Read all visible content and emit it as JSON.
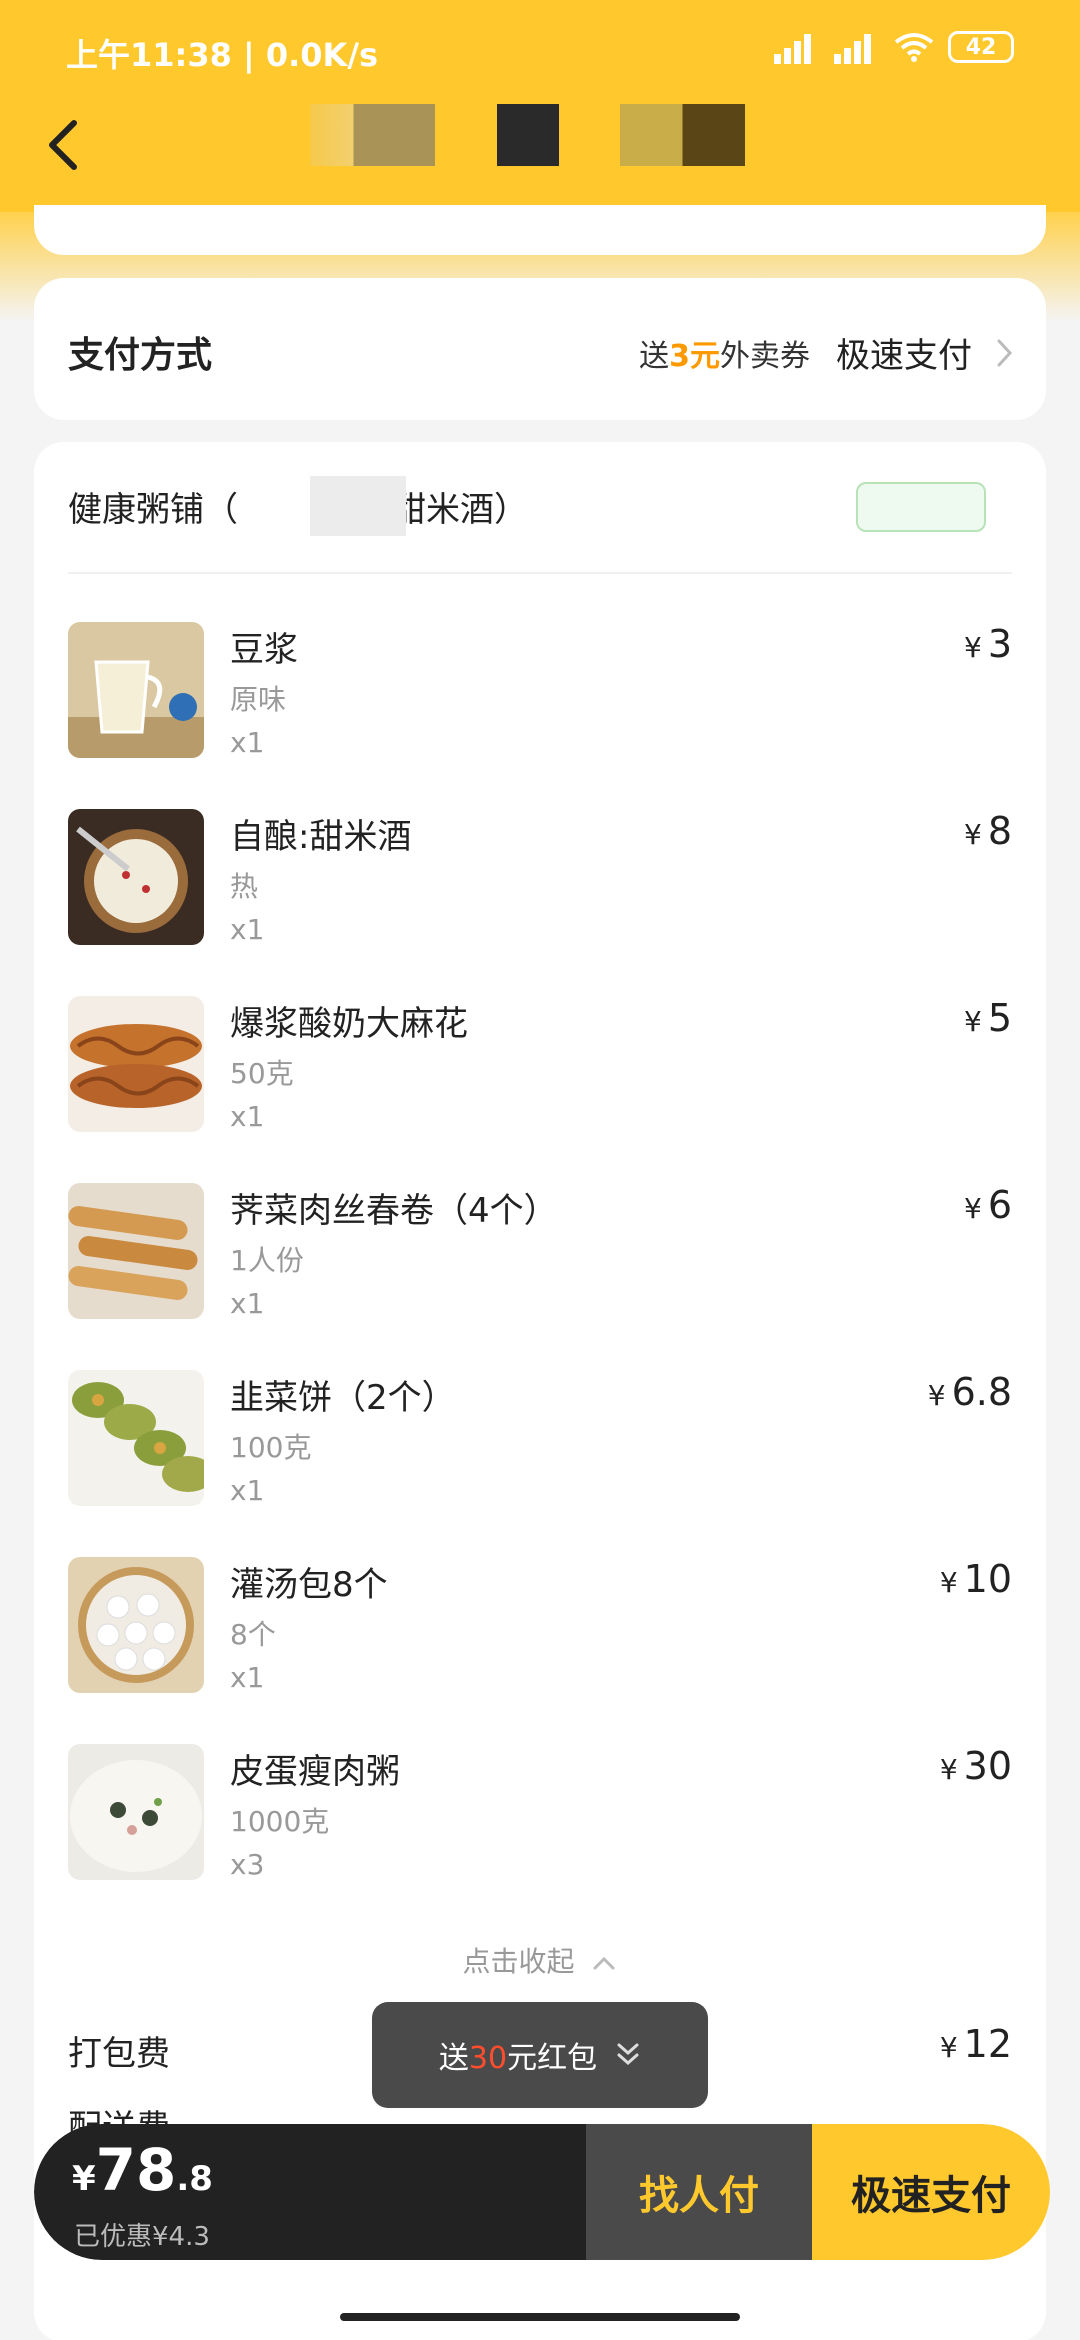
{
  "status_bar": {
    "time": "上午11:38 | 0.0K/s",
    "battery": "42"
  },
  "payment": {
    "title": "支付方式",
    "promo_prefix": "送",
    "promo_amount": "3元",
    "promo_suffix": "外卖券",
    "method": "极速支付"
  },
  "shop": {
    "name": "健康粥铺（",
    "name_tail": "，甜米酒）"
  },
  "items": [
    {
      "name": "豆浆",
      "spec": "原味",
      "qty": "x1",
      "currency": "¥",
      "price": "3"
    },
    {
      "name": "自酿:甜米酒",
      "spec": "热",
      "qty": "x1",
      "currency": "¥",
      "price": "8"
    },
    {
      "name": "爆浆酸奶大麻花",
      "spec": "50克",
      "qty": "x1",
      "currency": "¥",
      "price": "5"
    },
    {
      "name": "荠菜肉丝春卷（4个）",
      "spec": "1人份",
      "qty": "x1",
      "currency": "¥",
      "price": "6"
    },
    {
      "name": "韭菜饼（2个）",
      "spec": "100克",
      "qty": "x1",
      "currency": "¥",
      "price": "6.8"
    },
    {
      "name": "灌汤包8个",
      "spec": "8个",
      "qty": "x1",
      "currency": "¥",
      "price": "10"
    },
    {
      "name": "皮蛋瘦肉粥",
      "spec": "1000克",
      "qty": "x3",
      "currency": "¥",
      "price": "30"
    }
  ],
  "collapse_label": "点击收起",
  "packing_fee": {
    "label": "打包费",
    "currency": "¥",
    "price": "12"
  },
  "delivery_fee": {
    "label": "配送费"
  },
  "toast": {
    "prefix": "送",
    "amount": "30",
    "suffix": "元红包"
  },
  "bottom": {
    "currency": "¥",
    "total_int": "78",
    "total_dec": ".8",
    "saved": "已优惠¥4.3",
    "find_pay": "找人付",
    "fast_pay": "极速支付"
  },
  "colors": {
    "brand_yellow": "#ffc82c",
    "promo_orange": "#ff9900",
    "toast_red": "#ff4d2e"
  }
}
